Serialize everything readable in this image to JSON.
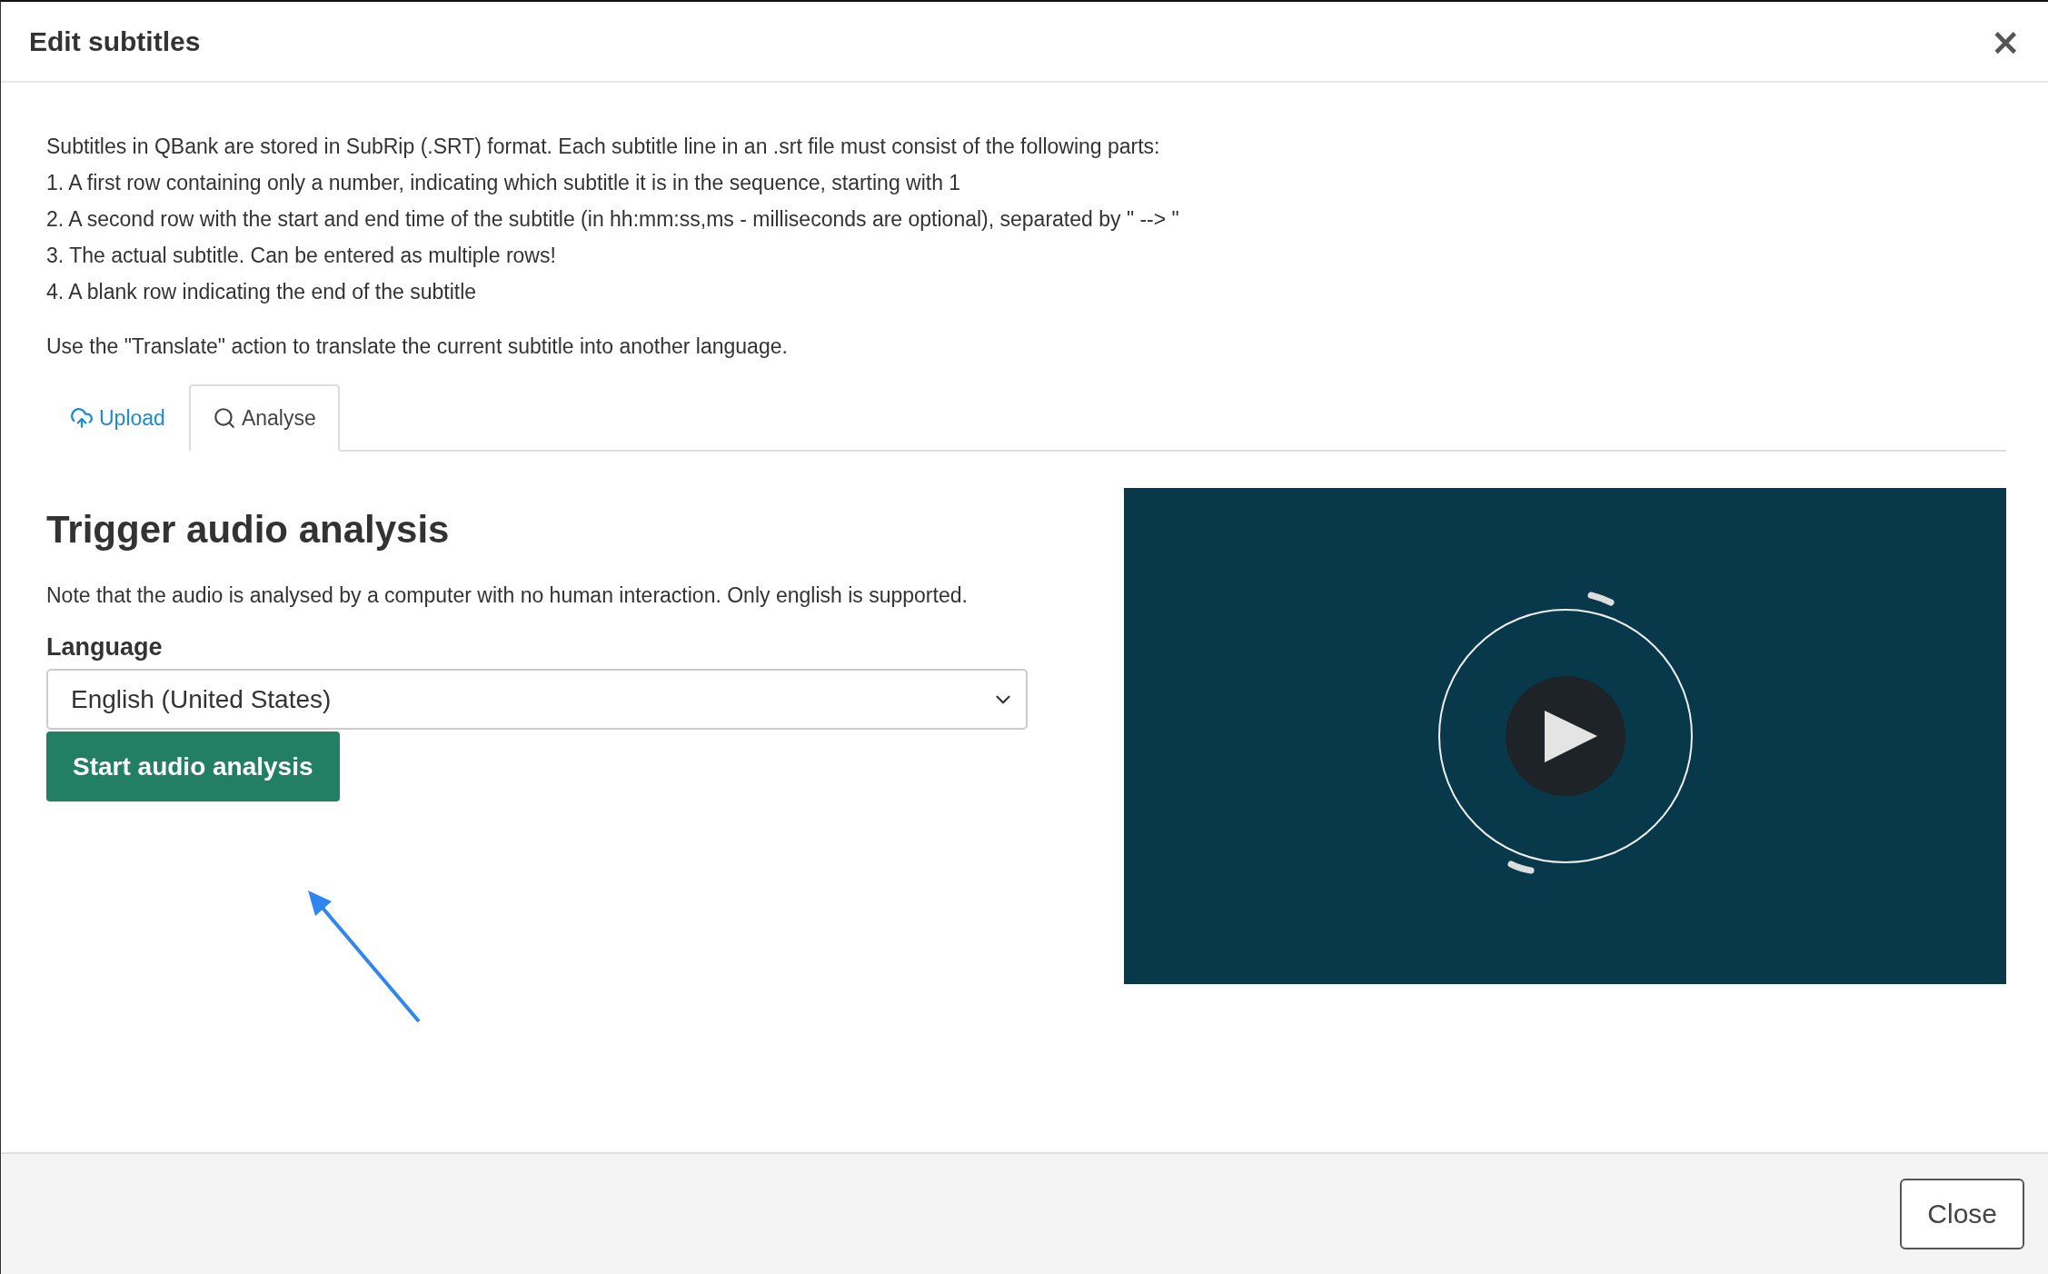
{
  "dialog": {
    "title": "Edit subtitles",
    "close_icon": "×"
  },
  "instructions": [
    "Subtitles in QBank are stored in SubRip (.SRT) format. Each subtitle line in an .srt file must consist of the following parts:",
    "1. A first row containing only a number, indicating which subtitle it is in the sequence, starting with 1",
    "2. A second row with the start and end time of the subtitle (in hh:mm:ss,ms - milliseconds are optional), separated by \" --> \"",
    "3. The actual subtitle. Can be entered as multiple rows!",
    "4. A blank row indicating the end of the subtitle"
  ],
  "translate_note": "Use the \"Translate\" action to translate the current subtitle into another language.",
  "tabs": [
    {
      "label": "Upload",
      "kind": "upload",
      "selected": false
    },
    {
      "label": "Analyse",
      "kind": "search",
      "selected": true
    }
  ],
  "analysis": {
    "heading": "Trigger audio analysis",
    "note": "Note that the audio is analysed by a computer with no human interaction. Only english is supported.",
    "language_label": "Language",
    "language_value": "English (United States)",
    "start_button": "Start audio analysis"
  },
  "footer": {
    "close_button": "Close"
  }
}
